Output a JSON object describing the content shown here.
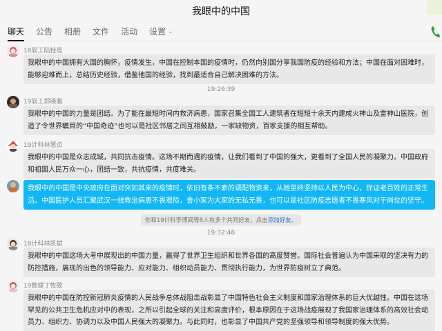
{
  "window": {
    "title": "我眼中的中国"
  },
  "tabs": [
    {
      "label": "聊天"
    },
    {
      "label": "公告"
    },
    {
      "label": "相册"
    },
    {
      "label": "文件"
    },
    {
      "label": "活动"
    },
    {
      "label": "设置"
    }
  ],
  "messages": [
    {
      "sender": "18软工陆桂焉",
      "text": "我眼中的中国拥有大国的胸怀，疫情发生，中国在控制本国的疫情时，仍然向别国分享我国防疫的经验和方法；中国在面对困难时，能够迎难而上，总结历史经验，借鉴他国的经验，找到最适合自己解决困难的方法。"
    },
    {
      "timestamp": "19:26:39",
      "sender": "19软工郑晓雅",
      "text": "我眼中的中国的力量是团结。为了能在最短时间内救济病患，国家召集全国工人建筑者在短短十余天内建成火神山及雷神山医院，创造了令世界瞩目的“中国奇迹”也可以是社区邻居之间互相鼓励，一家缺物资，百家支援的相互帮助。"
    },
    {
      "sender": "19计科林慧贞",
      "text": "我眼中的中国是众志成城，共同抗击疫情。这场不期而遇的疫情，让我们看到了中国的强大，更看到了全国人民的凝聚力。中国政府和祖国人民万众一心，团结一致，共抗疫情，共度难关。"
    },
    {
      "self": true,
      "text": "我眼中的中国是中央政府在面对突如其来的疫情时，依旧有条不紊的调配物资来，从她至终坚持以人民为中心，保证老百姓的正常生活。中国医护人员汇聚武汉一线救治病患不畏艰险，舍小家为大家的无私无畏，也可以是社区防疫志愿者不畏寒风对于岗位的坚守。"
    },
    {
      "notice_prefix": "你和19计科李博阅等8人有多个共同好友，点击",
      "notice_link": "添加好友",
      "notice_suffix": "。"
    },
    {
      "timestamp": "19:32:46",
      "sender": "18计科林凯斌",
      "text": "我眼中的中国这场大考中展现出的中国力量，赢得了世界卫生组织和世界各国的高度赞誉。国际社会普遍认为中国采取的坚决有力的防控措施，展现的出色的领导能力、应对能力、组织动员能力、贯彻执行能力，为世界防疫树立了典范。"
    },
    {
      "sender": "19数媒丁牧歌",
      "text": "我眼中的中国在防控新冠肺炎疫情的人民战争总体战阻击战彰显了中国特色社会主义制度和国家治理体系的巨大优越性。中国在这场罕见的公共卫生危机应对中的表现，之所以引起全球的关注和高度评价，根本原因在于这场战疫展现了我国家治理体系的高效社会动员力、组织力、协调力以及中国人民强大的凝聚力。与此同时，也彰显了中国共产党的坚强领导和领导制度的强大优势。"
    }
  ],
  "colors": {
    "self_bubble": "#12b7f5",
    "other_bubble": "#e8e8e8",
    "link": "#2d7ad6",
    "phone": "#2ba245"
  }
}
